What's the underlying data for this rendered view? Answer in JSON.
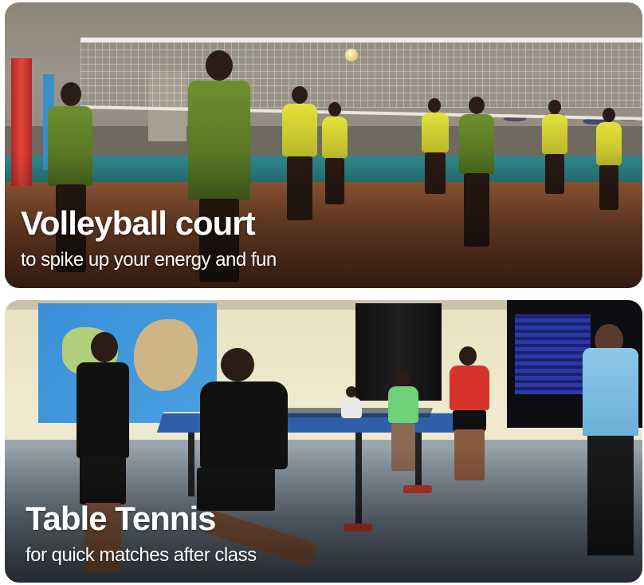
{
  "cards": [
    {
      "title": "Volleyball court",
      "subtitle": "to spike up your energy and fun"
    },
    {
      "title": "Table Tennis",
      "subtitle": "for quick matches after class"
    }
  ]
}
